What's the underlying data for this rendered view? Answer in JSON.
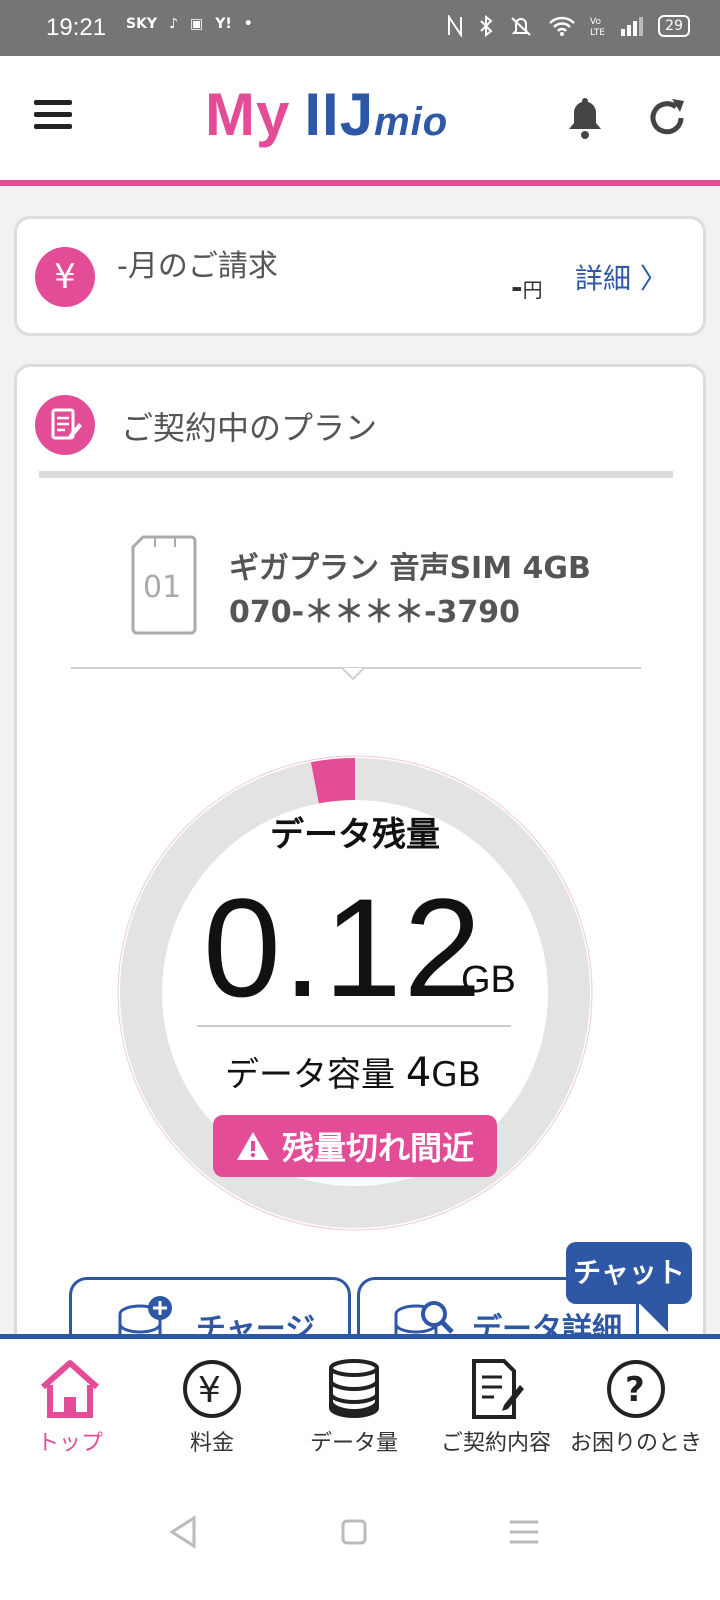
{
  "status_bar": {
    "time": "19:21",
    "left_icons": [
      "SKY",
      "♪",
      "▣",
      "Y!",
      "•"
    ],
    "battery": "29"
  },
  "header": {
    "logo_my": "My",
    "logo_iij": "IIJ",
    "logo_mio": "mio"
  },
  "billing": {
    "title": "-月のご請求",
    "amount": "-",
    "currency": "円",
    "detail_link": "詳細 〉"
  },
  "plan": {
    "title": "ご契約中のプラン",
    "sim_number": "01",
    "name": "ギガプラン 音声SIM 4GB",
    "phone": "070-＊＊＊＊-3790"
  },
  "data_gauge": {
    "label": "データ残量",
    "remaining": "0.12",
    "remaining_unit": "GB",
    "capacity_label": "データ容量 ",
    "capacity_value": "4",
    "capacity_unit": "GB",
    "remaining_fraction": 0.03,
    "warning": "残量切れ間近"
  },
  "actions": {
    "charge": "チャージ",
    "data_detail": "データ詳細"
  },
  "chat": {
    "label": "チャット"
  },
  "bottom_nav": {
    "items": [
      {
        "label": "トップ",
        "icon": "home-icon",
        "active": true
      },
      {
        "label": "料金",
        "icon": "yen-icon"
      },
      {
        "label": "データ量",
        "icon": "database-icon"
      },
      {
        "label": "ご契約内容",
        "icon": "contract-icon"
      },
      {
        "label": "お困りのとき",
        "icon": "help-icon"
      }
    ]
  },
  "colors": {
    "brand_pink": "#e34d97",
    "brand_blue": "#2e58a6"
  }
}
